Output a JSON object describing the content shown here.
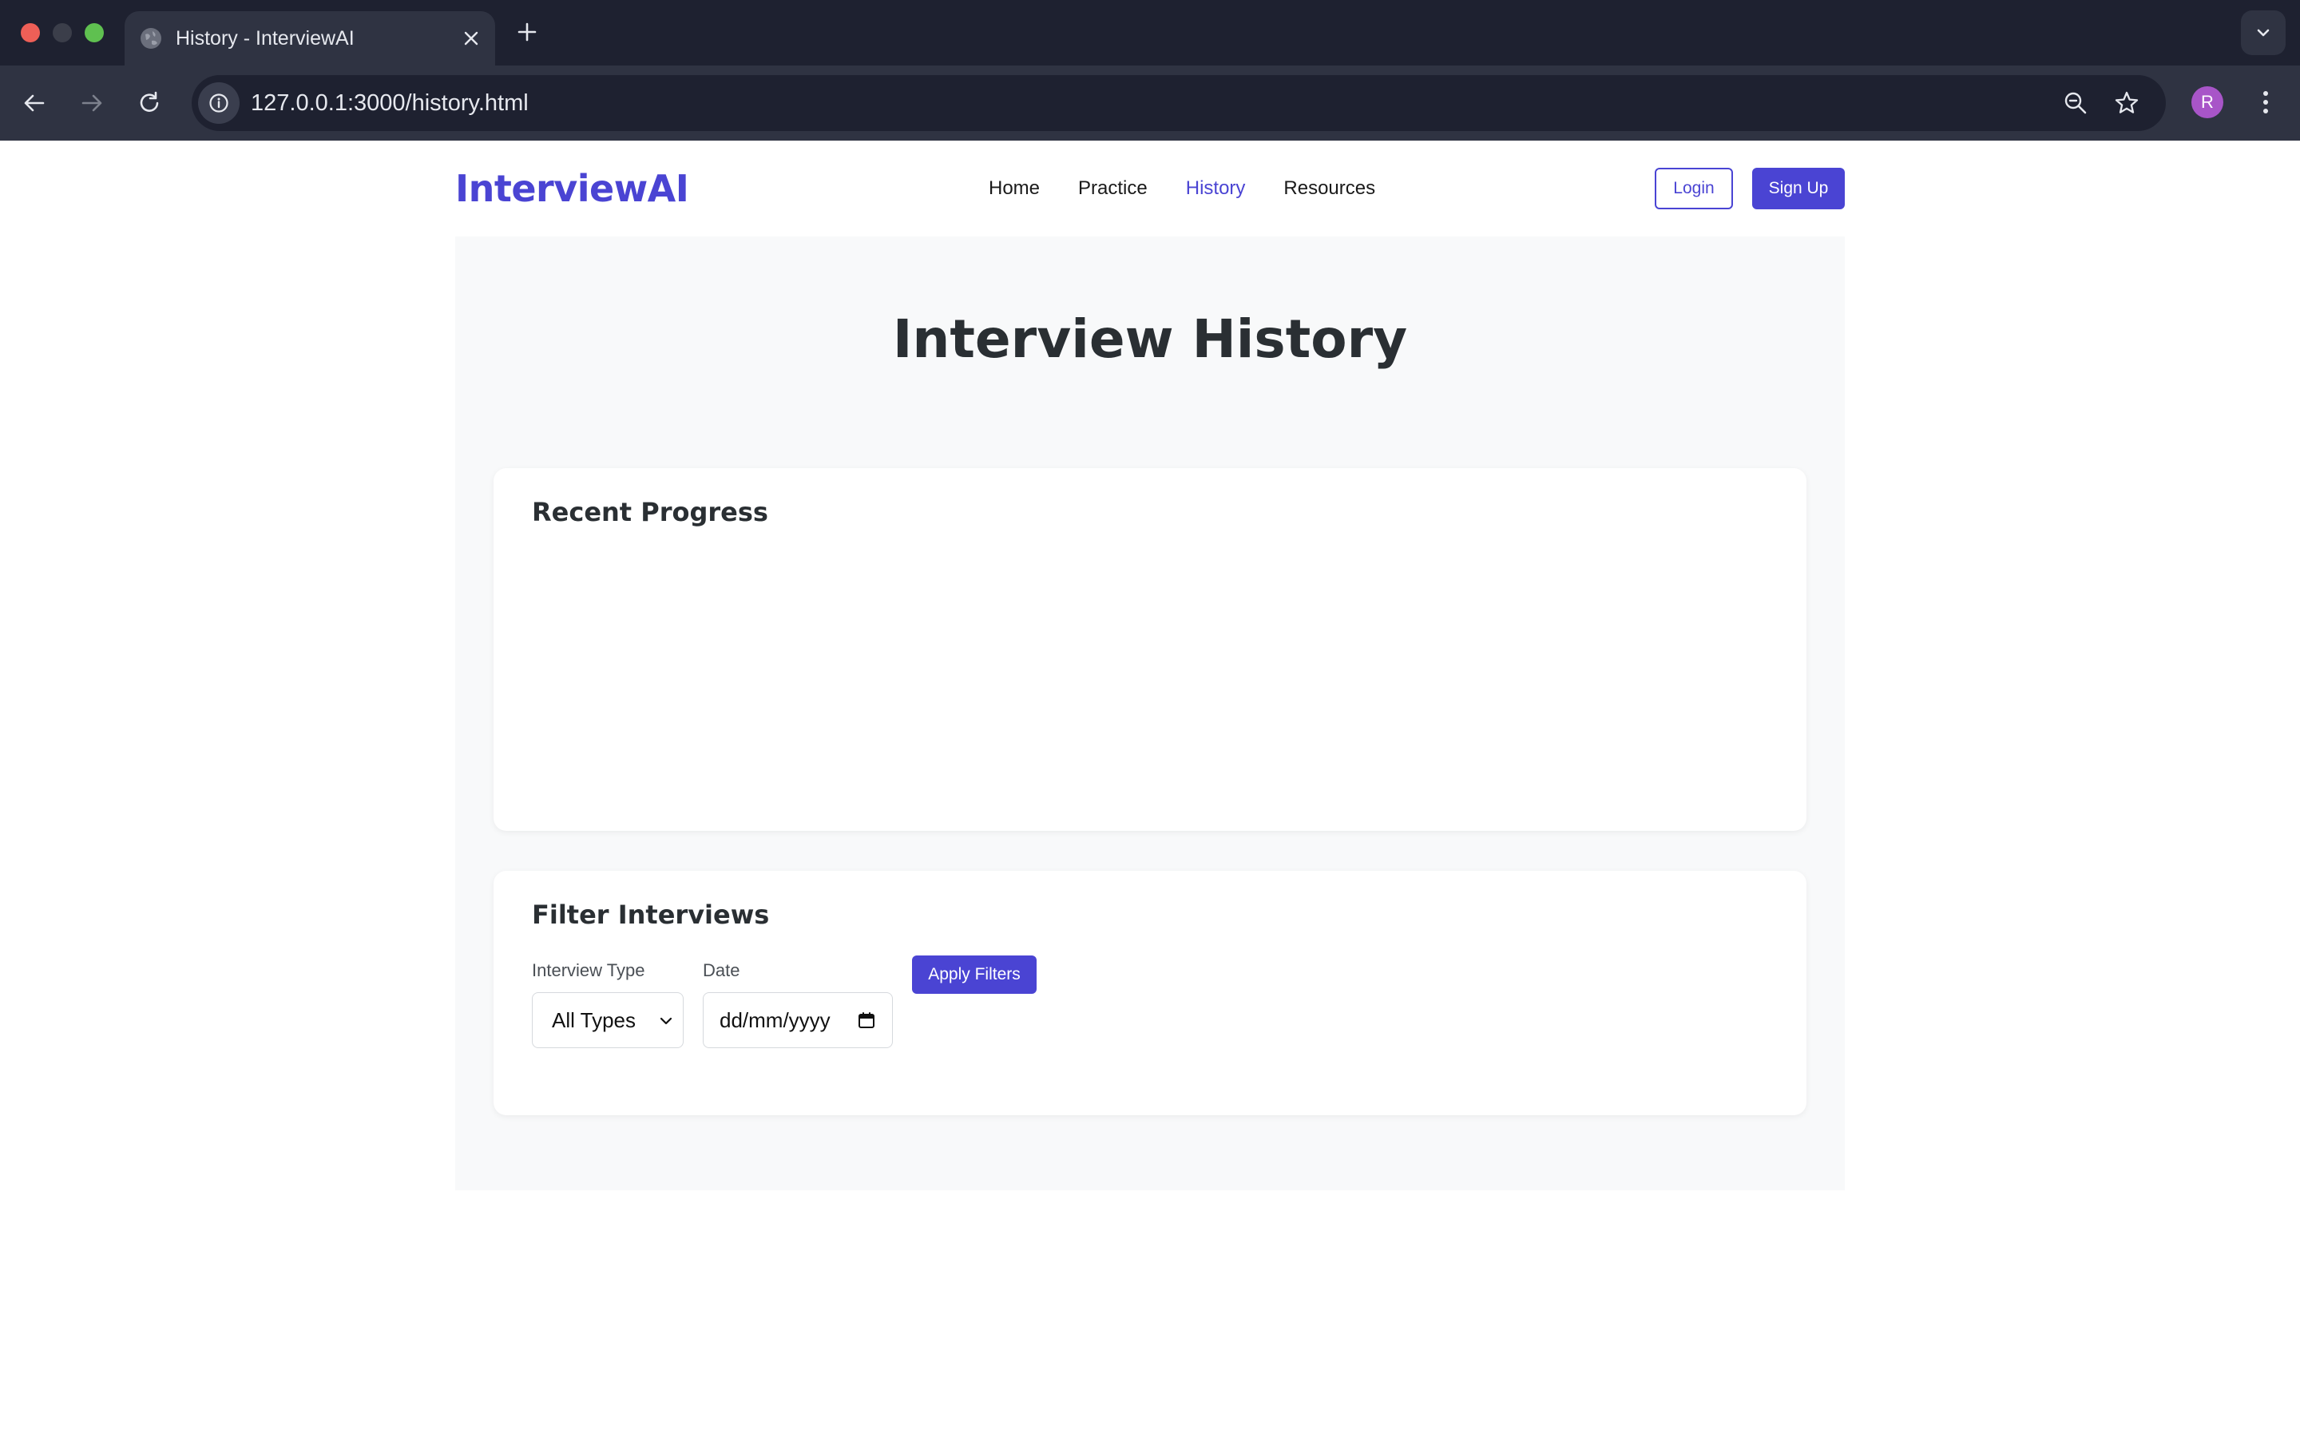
{
  "browser": {
    "tab_title": "History - InterviewAI",
    "url": "127.0.0.1:3000/history.html",
    "profile_initial": "R"
  },
  "site": {
    "logo": "InterviewAI",
    "nav": [
      {
        "label": "Home",
        "active": false
      },
      {
        "label": "Practice",
        "active": false
      },
      {
        "label": "History",
        "active": true
      },
      {
        "label": "Resources",
        "active": false
      }
    ],
    "login_label": "Login",
    "signup_label": "Sign Up"
  },
  "main": {
    "title": "Interview History",
    "progress": {
      "heading": "Recent Progress"
    },
    "filters": {
      "heading": "Filter Interviews",
      "type_label": "Interview Type",
      "type_value": "All Types",
      "date_label": "Date",
      "date_placeholder": "dd/mm/yyyy",
      "apply_label": "Apply Filters"
    }
  },
  "colors": {
    "accent": "#4a44d3",
    "chrome_dark": "#1e2130",
    "chrome_mid": "#2f3342",
    "page_bg": "#f8f9fa"
  },
  "icons": [
    "globe-icon",
    "close-icon",
    "plus-icon",
    "chevron-down-icon",
    "back-arrow-icon",
    "forward-arrow-icon",
    "reload-icon",
    "info-icon",
    "zoom-out-icon",
    "star-icon",
    "more-vert-icon",
    "calendar-icon"
  ]
}
